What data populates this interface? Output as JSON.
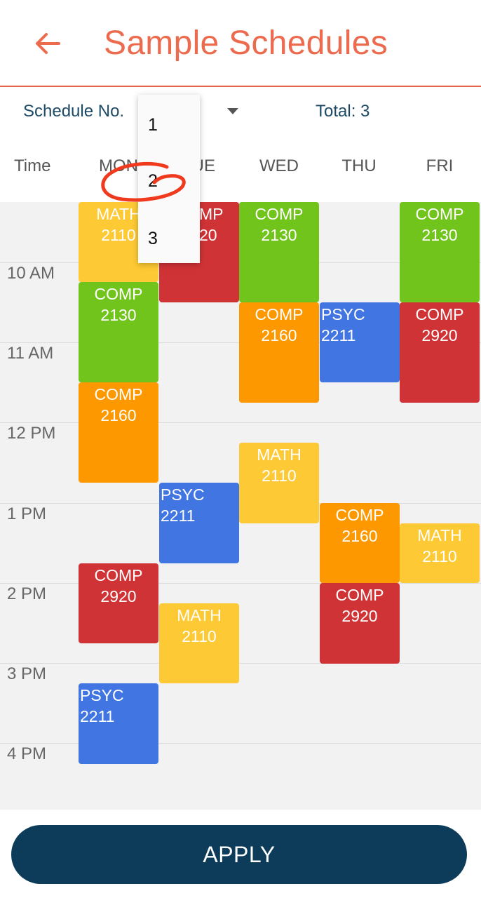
{
  "header": {
    "title": "Sample Schedules",
    "back_icon": "arrow-left-icon"
  },
  "controls": {
    "schedule_label": "Schedule No.",
    "total_label": "Total: 3",
    "time_header": "Time",
    "days": [
      "MON",
      "TUE",
      "WED",
      "THU",
      "FRI"
    ]
  },
  "dropdown": {
    "options": [
      "1",
      "2",
      "3"
    ],
    "annotated_option": "2"
  },
  "times": [
    "10 AM",
    "11 AM",
    "12 PM",
    "1 PM",
    "2 PM",
    "3 PM",
    "4 PM"
  ],
  "blocks": [
    {
      "label": "MATH 2110",
      "day": "MON",
      "start": "9:00",
      "end": "10:00",
      "color": "#fdc934"
    },
    {
      "label": "COMP 2130",
      "day": "MON",
      "start": "10:00",
      "end": "11:15",
      "color": "#71c41b"
    },
    {
      "label": "COMP 2160",
      "day": "MON",
      "start": "11:15",
      "end": "12:30",
      "color": "#fd9800"
    },
    {
      "label": "COMP 2920",
      "day": "MON",
      "start": "13:30",
      "end": "14:30",
      "color": "#d03336"
    },
    {
      "label": "PSYC 2211",
      "day": "MON",
      "start": "15:00",
      "end": "16:00",
      "color": "#4175e1"
    },
    {
      "label": "COMP 2920",
      "day": "TUE",
      "start": "9:00",
      "end": "10:15",
      "color": "#d03336"
    },
    {
      "label": "PSYC 2211",
      "day": "TUE",
      "start": "12:30",
      "end": "13:30",
      "color": "#4175e1"
    },
    {
      "label": "MATH 2110",
      "day": "TUE",
      "start": "14:00",
      "end": "15:00",
      "color": "#fdc934"
    },
    {
      "label": "COMP 2130",
      "day": "WED",
      "start": "9:00",
      "end": "10:15",
      "color": "#71c41b"
    },
    {
      "label": "COMP 2160",
      "day": "WED",
      "start": "10:15",
      "end": "11:30",
      "color": "#fd9800"
    },
    {
      "label": "MATH 2110",
      "day": "WED",
      "start": "12:00",
      "end": "13:00",
      "color": "#fdc934"
    },
    {
      "label": "PSYC 2211",
      "day": "THU",
      "start": "10:15",
      "end": "11:15",
      "color": "#4175e1"
    },
    {
      "label": "COMP 2160",
      "day": "THU",
      "start": "12:45",
      "end": "13:45",
      "color": "#fd9800"
    },
    {
      "label": "COMP 2920",
      "day": "THU",
      "start": "13:45",
      "end": "14:45",
      "color": "#d03336"
    },
    {
      "label": "COMP 2130",
      "day": "FRI",
      "start": "9:00",
      "end": "10:15",
      "color": "#71c41b"
    },
    {
      "label": "COMP 2920",
      "day": "FRI",
      "start": "10:15",
      "end": "11:30",
      "color": "#d03336"
    },
    {
      "label": "MATH 2110",
      "day": "FRI",
      "start": "13:00",
      "end": "13:45",
      "color": "#fdc934"
    }
  ],
  "footer": {
    "apply_label": "APPLY"
  }
}
